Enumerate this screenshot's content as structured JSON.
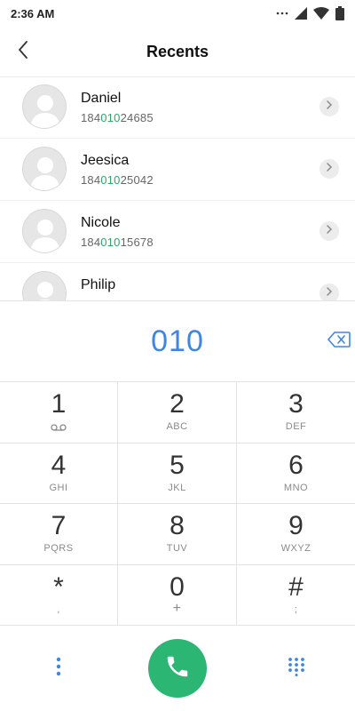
{
  "status_bar": {
    "time": "2:36 AM",
    "icons": [
      "more-dots-icon",
      "signal-icon",
      "wifi-icon",
      "battery-icon"
    ]
  },
  "header": {
    "title": "Recents",
    "back_icon": "chevron-left-icon"
  },
  "recents": [
    {
      "name": "Daniel",
      "number_prefix": "184",
      "number_match": "010",
      "number_suffix": "24685"
    },
    {
      "name": "Jeesica",
      "number_prefix": "184",
      "number_match": "010",
      "number_suffix": "25042"
    },
    {
      "name": "Nicole",
      "number_prefix": "184",
      "number_match": "010",
      "number_suffix": "15678"
    },
    {
      "name": "Philip",
      "number_prefix": "",
      "number_match": "",
      "number_suffix": ""
    }
  ],
  "dialer": {
    "dialed_number": "010",
    "backspace_icon": "backspace-icon"
  },
  "keypad": [
    {
      "digit": "1",
      "letters": "",
      "sub_icon": "voicemail-icon"
    },
    {
      "digit": "2",
      "letters": "ABC"
    },
    {
      "digit": "3",
      "letters": "DEF"
    },
    {
      "digit": "4",
      "letters": "GHI"
    },
    {
      "digit": "5",
      "letters": "JKL"
    },
    {
      "digit": "6",
      "letters": "MNO"
    },
    {
      "digit": "7",
      "letters": "PQRS"
    },
    {
      "digit": "8",
      "letters": "TUV"
    },
    {
      "digit": "9",
      "letters": "WXYZ"
    },
    {
      "digit": "*",
      "letters": ","
    },
    {
      "digit": "0",
      "letters": "+"
    },
    {
      "digit": "#",
      "letters": ";"
    }
  ],
  "actions": {
    "more_icon": "more-vertical-icon",
    "call_icon": "phone-icon",
    "keypad_icon": "dialpad-icon"
  },
  "colors": {
    "accent_blue": "#3f86e0",
    "match_green": "#2fa66a",
    "call_green": "#2bb673"
  }
}
